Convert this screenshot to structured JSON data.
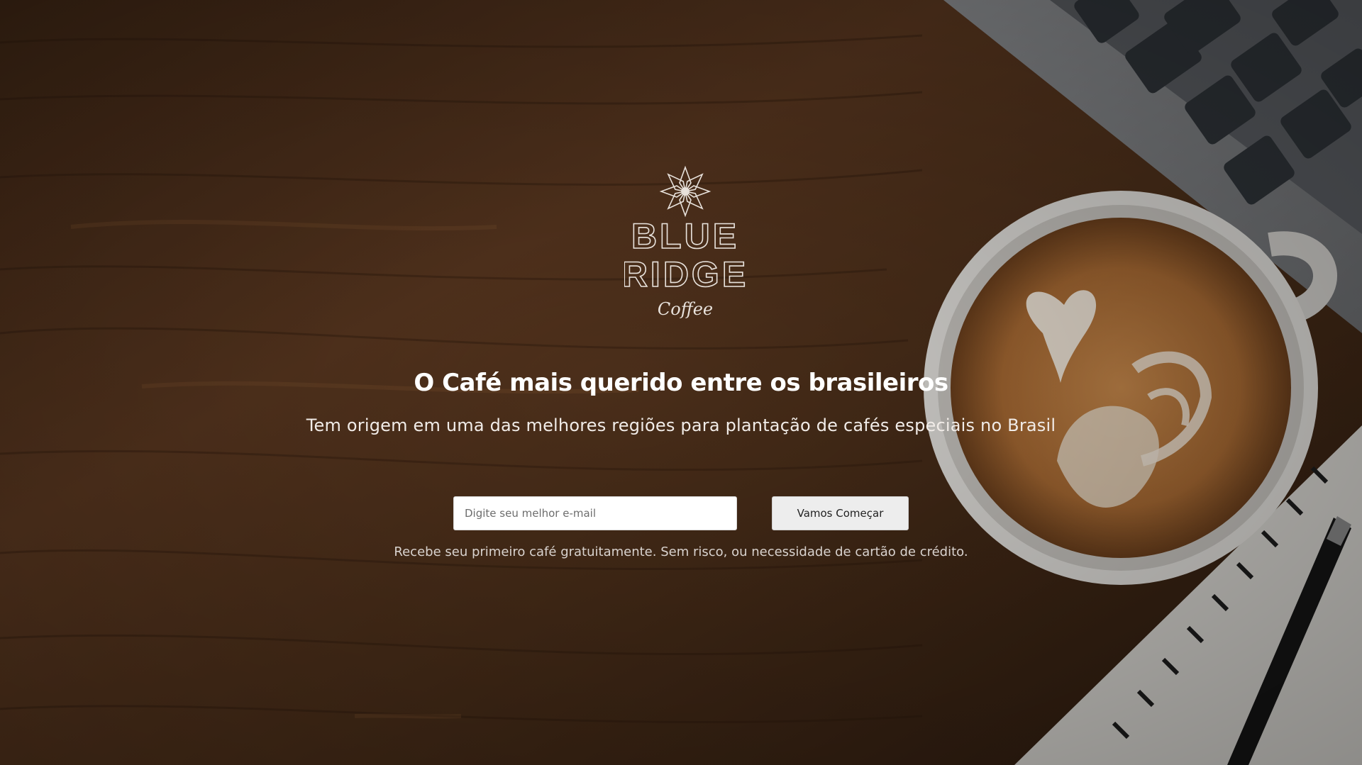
{
  "brand": {
    "logo_line1": "BLUE",
    "logo_line2": "RIDGE",
    "logo_line3": "Coffee"
  },
  "hero": {
    "headline": "O Café mais querido entre os brasileiros",
    "subheadline": "Tem origem em uma das melhores regiões para plantação de cafés especiais no Brasil"
  },
  "signup": {
    "email_placeholder": "Digite seu melhor e-mail",
    "email_value": "",
    "button_label": "Vamos Começar",
    "note": "Recebe seu primeiro café gratuitamente. Sem risco, ou necessidade de cartão de crédito."
  },
  "colors": {
    "wood_dark": "#3a2414",
    "wood_mid": "#6b4226",
    "text_primary": "#ffffff",
    "button_bg": "#ededed"
  },
  "icons": {
    "logo_mark": "star-flower-icon"
  }
}
